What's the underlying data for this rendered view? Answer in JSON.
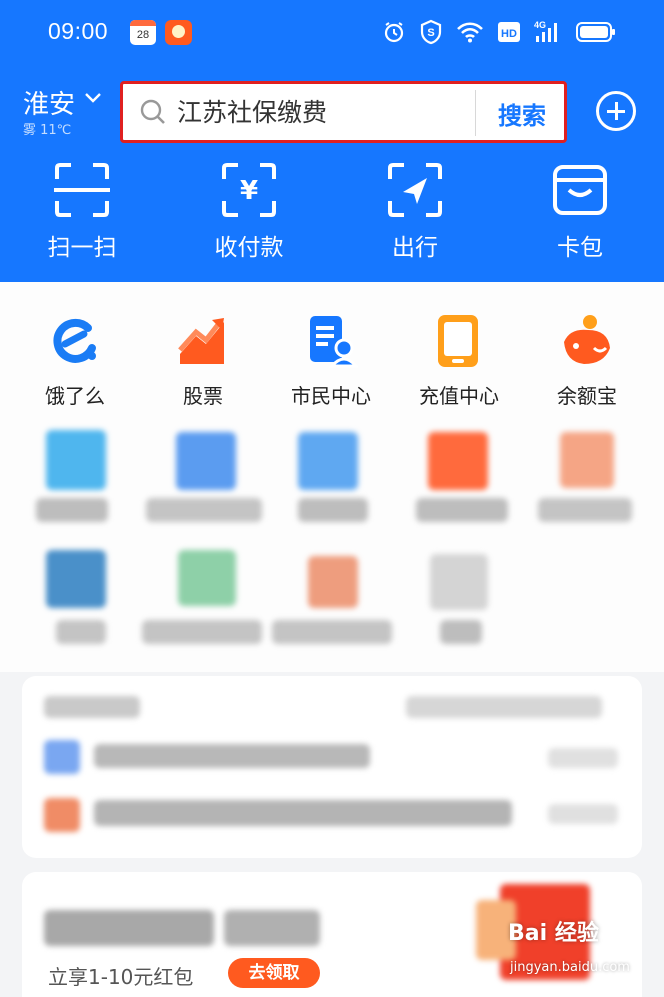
{
  "status_bar": {
    "time": "09:00",
    "calendar_day": "28",
    "icons": [
      "alarm-icon",
      "security-shield-icon",
      "wifi-icon",
      "hd-icon",
      "4g-signal-icon",
      "battery-icon"
    ],
    "hd_label": "HD",
    "network_label": "4G"
  },
  "header": {
    "city": "淮安",
    "weather": "雾 11℃",
    "search": {
      "value": "江苏社保缴费",
      "button_label": "搜索"
    },
    "add_icon": "plus-circle-icon"
  },
  "quick_actions": [
    {
      "label": "扫一扫",
      "icon": "scan-icon"
    },
    {
      "label": "收付款",
      "icon": "collect-pay-icon"
    },
    {
      "label": "出行",
      "icon": "travel-icon"
    },
    {
      "label": "卡包",
      "icon": "card-wallet-icon"
    }
  ],
  "apps": [
    {
      "label": "饿了么",
      "icon": "eleme-icon",
      "color": "#1a7cf5"
    },
    {
      "label": "股票",
      "icon": "stock-icon",
      "color": "#ff5a1f"
    },
    {
      "label": "市民中心",
      "icon": "citizen-center-icon",
      "color": "#1677ff"
    },
    {
      "label": "充值中心",
      "icon": "recharge-icon",
      "color": "#ff9f1a"
    },
    {
      "label": "余额宝",
      "icon": "yuebao-icon",
      "color": "#ff5a1f"
    }
  ],
  "promo": {
    "text": "立享1-10元红包",
    "button_label": "去领取"
  },
  "watermark": {
    "text": "Bai 经验",
    "url": "jingyan.baidu.com"
  },
  "colors": {
    "brand_blue": "#1677ff",
    "highlight_red": "#e02020",
    "orange": "#ff5a1f"
  }
}
